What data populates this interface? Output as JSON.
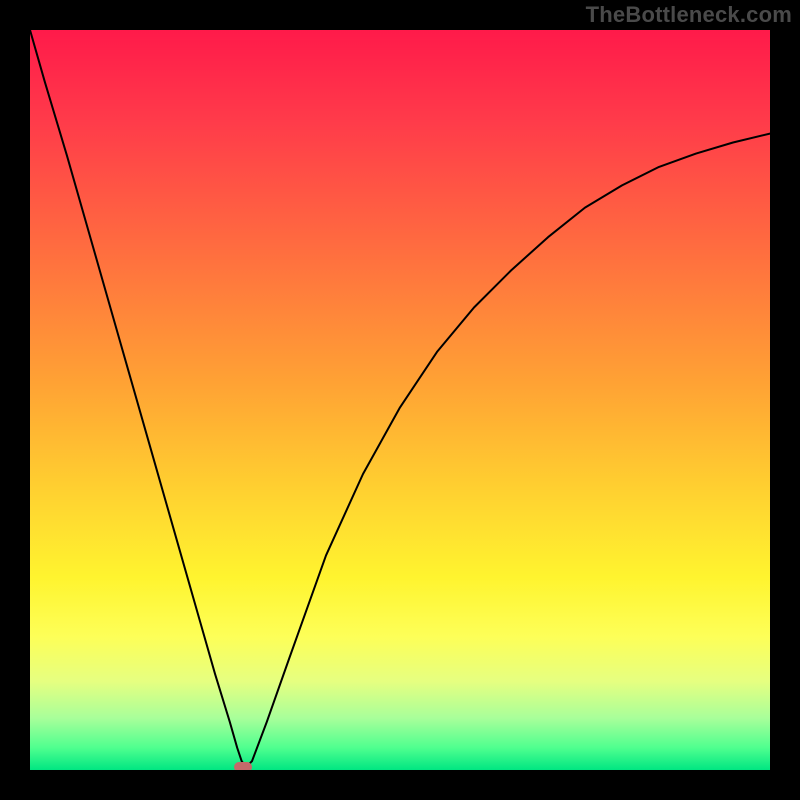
{
  "watermark": "TheBottleneck.com",
  "chart_data": {
    "type": "line",
    "title": "",
    "xlabel": "",
    "ylabel": "",
    "xlim": [
      0,
      100
    ],
    "ylim": [
      0,
      100
    ],
    "series": [
      {
        "name": "curve",
        "x": [
          0,
          2,
          5,
          8,
          12,
          16,
          20,
          23,
          25,
          27,
          28,
          28.6,
          29.2,
          30,
          32,
          35,
          40,
          45,
          50,
          55,
          60,
          65,
          70,
          75,
          80,
          85,
          90,
          95,
          100
        ],
        "y": [
          100,
          93,
          83,
          72.5,
          58.5,
          44.5,
          30.5,
          20,
          13,
          6.5,
          3,
          1.2,
          0.4,
          1.2,
          6.5,
          15,
          29,
          40,
          49,
          56.5,
          62.5,
          67.5,
          72,
          76,
          79,
          81.5,
          83.3,
          84.8,
          86
        ]
      }
    ],
    "marker": {
      "x": 28.8,
      "y": 0.4,
      "color": "#c46a6a"
    },
    "gradient_stops": [
      {
        "offset": 0.0,
        "color": "#ff1a4a"
      },
      {
        "offset": 0.12,
        "color": "#ff3a4a"
      },
      {
        "offset": 0.3,
        "color": "#ff6e3f"
      },
      {
        "offset": 0.48,
        "color": "#ffa334"
      },
      {
        "offset": 0.62,
        "color": "#ffd030"
      },
      {
        "offset": 0.74,
        "color": "#fff42f"
      },
      {
        "offset": 0.82,
        "color": "#fdff58"
      },
      {
        "offset": 0.88,
        "color": "#e6ff80"
      },
      {
        "offset": 0.93,
        "color": "#a8ff9a"
      },
      {
        "offset": 0.97,
        "color": "#4fff8f"
      },
      {
        "offset": 1.0,
        "color": "#00e682"
      }
    ]
  }
}
